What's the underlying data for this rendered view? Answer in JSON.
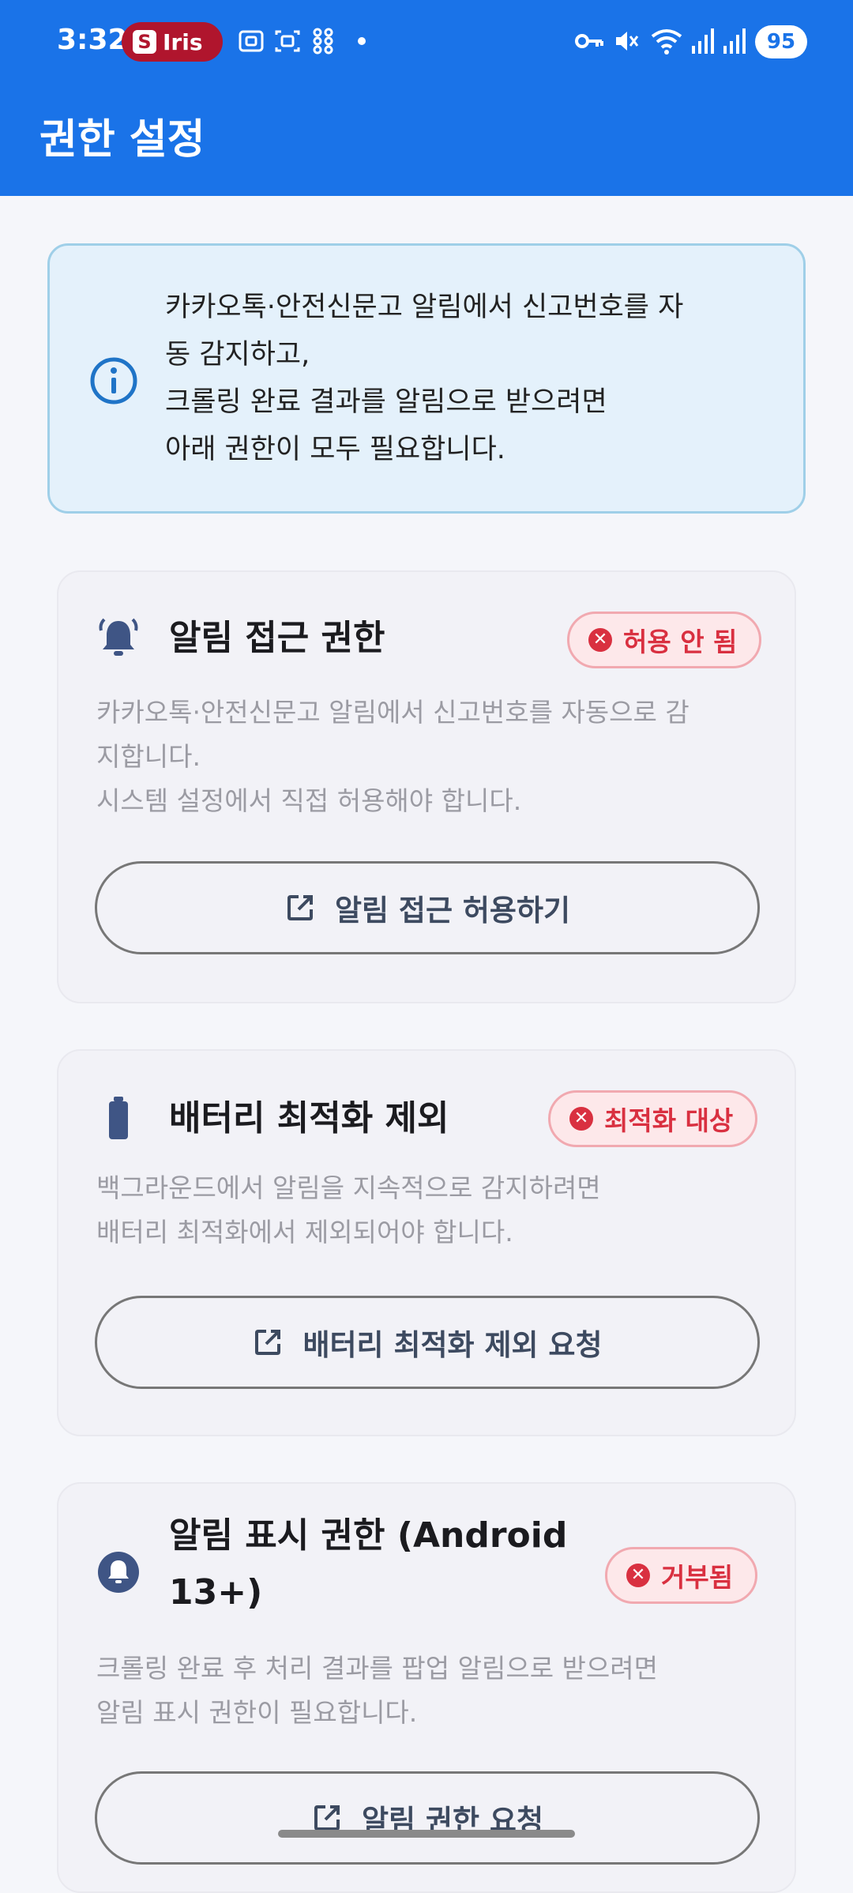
{
  "status_bar": {
    "time": "3:32",
    "iris_label": "Iris",
    "iris_logo": "S",
    "battery": "95",
    "icons": [
      "screenshot-icon",
      "screen-record-icon",
      "grid-icon",
      "dot-icon",
      "vpn-key-icon",
      "mute-icon",
      "wifi-icon",
      "signal-icon",
      "signal-icon"
    ]
  },
  "appbar": {
    "title": "권한 설정"
  },
  "info": {
    "icon": "info-icon",
    "lines": [
      "카카오톡·안전신문고 알림에서 신고번호를 자",
      "동 감지하고,",
      "크롤링 완료 결과를 알림으로 받으려면",
      "아래 권한이 모두 필요합니다."
    ]
  },
  "cards": [
    {
      "icon": "notification-access-bell-icon",
      "title": "알림 접근 권한",
      "badge": "허용 안 됨",
      "desc": [
        "카카오톡·안전신문고 알림에서 신고번호를 자동으로 감",
        "지합니다.",
        "시스템 설정에서 직접 허용해야 합니다."
      ],
      "button": "알림 접근 허용하기"
    },
    {
      "icon": "battery-icon",
      "title": "배터리 최적화 제외",
      "badge": "최적화 대상",
      "desc": [
        "백그라운드에서 알림을 지속적으로 감지하려면",
        "배터리 최적화에서 제외되어야 합니다."
      ],
      "button": "배터리 최적화 제외 요청"
    },
    {
      "icon": "notification-bell-icon",
      "title_lines": [
        "알림 표시 권한 (Android",
        "13+)"
      ],
      "badge": "거부됨",
      "desc": [
        "크롤링 완료 후 처리 결과를 팝업 알림으로 받으려면",
        "알림 표시 권한이 필요합니다."
      ],
      "button": "알림 권한 요청"
    }
  ],
  "colors": {
    "primary": "#1a73e8",
    "badge_red": "#d93040",
    "info_bg": "#e4f1fb",
    "icon_navy": "#3f5585"
  }
}
